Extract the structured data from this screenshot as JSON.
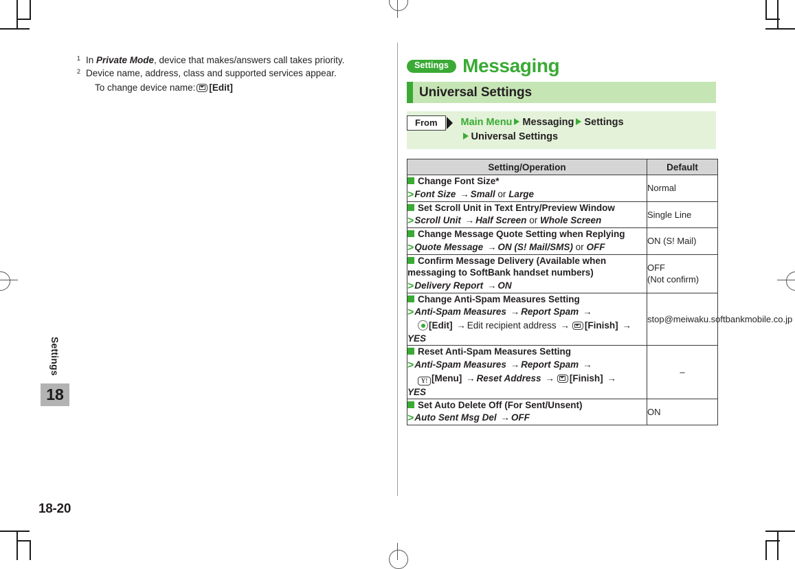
{
  "footnotes": [
    {
      "marker": "1",
      "pre": "In ",
      "emphasis": "Private Mode",
      "post": ", device that makes/answers call takes priority."
    },
    {
      "marker": "2",
      "pre": "",
      "emphasis": "",
      "post": "Device name, address, class and supported services appear.",
      "sub_pre": "To change device name: ",
      "sub_key": "envelope-key-icon",
      "sub_post": "[Edit]"
    }
  ],
  "side_tab": {
    "label": "Settings",
    "chapter": "18"
  },
  "folio": "18-20",
  "header": {
    "pill": "Settings",
    "title": "Messaging",
    "section": "Universal Settings"
  },
  "from_block": {
    "tag": "From",
    "crumbs_line1": [
      "Main Menu",
      "Messaging",
      "Settings"
    ],
    "crumbs_line2": [
      "Universal Settings"
    ]
  },
  "table": {
    "columns": [
      "Setting/Operation",
      "Default"
    ],
    "rows": [
      {
        "heading": "Change Font Size*",
        "steps": [
          {
            "parts": [
              {
                "t": "Font Size",
                "s": "bi"
              },
              {
                "t": "→",
                "s": "arrow"
              },
              {
                "t": "Small",
                "s": "bi"
              },
              {
                "t": "or",
                "s": "plain"
              },
              {
                "t": "Large",
                "s": "bi"
              }
            ]
          }
        ],
        "default": "Normal",
        "default_align": "left"
      },
      {
        "heading": "Set Scroll Unit in Text Entry/Preview Window",
        "steps": [
          {
            "parts": [
              {
                "t": "Scroll Unit",
                "s": "bi"
              },
              {
                "t": "→",
                "s": "arrow"
              },
              {
                "t": "Half Screen",
                "s": "bi"
              },
              {
                "t": "or",
                "s": "plain"
              },
              {
                "t": "Whole Screen",
                "s": "bi"
              }
            ]
          }
        ],
        "default": "Single Line",
        "default_align": "left"
      },
      {
        "heading": "Change Message Quote Setting when Replying",
        "steps": [
          {
            "parts": [
              {
                "t": "Quote Message",
                "s": "bi"
              },
              {
                "t": "→",
                "s": "arrow"
              },
              {
                "t": "ON (S! Mail/SMS)",
                "s": "bi"
              },
              {
                "t": "or",
                "s": "plain"
              },
              {
                "t": "OFF",
                "s": "bi"
              }
            ]
          }
        ],
        "default": "ON (S! Mail)",
        "default_align": "left"
      },
      {
        "heading": "Confirm Message Delivery (Available when messaging to SoftBank handset numbers)",
        "steps": [
          {
            "parts": [
              {
                "t": "Delivery Report",
                "s": "bi"
              },
              {
                "t": "→",
                "s": "arrow"
              },
              {
                "t": "ON",
                "s": "bi"
              }
            ]
          }
        ],
        "default": "OFF\n(Not confirm)",
        "default_align": "left"
      },
      {
        "heading": "Change Anti-Spam Measures Setting",
        "steps": [
          {
            "parts": [
              {
                "t": "Anti-Spam Measures",
                "s": "bi"
              },
              {
                "t": "→",
                "s": "arrow"
              },
              {
                "t": "Report Spam",
                "s": "bi"
              },
              {
                "t": "→",
                "s": "arrow"
              }
            ]
          },
          {
            "indent": true,
            "parts": [
              {
                "t": "center-key-icon",
                "s": "key-center"
              },
              {
                "t": "[Edit]",
                "s": "b"
              },
              {
                "t": "→",
                "s": "arrow"
              },
              {
                "t": "Edit recipient address",
                "s": "plain"
              },
              {
                "t": "→",
                "s": "arrow"
              },
              {
                "t": "envelope-key-icon",
                "s": "key-env"
              },
              {
                "t": "[Finish]",
                "s": "b"
              },
              {
                "t": "→",
                "s": "arrow"
              }
            ]
          },
          {
            "parts": [
              {
                "t": "YES",
                "s": "bi"
              }
            ]
          }
        ],
        "default": "stop@meiwaku.softbankmobile.co.jp",
        "default_align": "left"
      },
      {
        "heading": "Reset Anti-Spam Measures Setting",
        "steps": [
          {
            "parts": [
              {
                "t": "Anti-Spam Measures",
                "s": "bi"
              },
              {
                "t": "→",
                "s": "arrow"
              },
              {
                "t": "Report Spam",
                "s": "bi"
              },
              {
                "t": "→",
                "s": "arrow"
              }
            ]
          },
          {
            "indent": true,
            "parts": [
              {
                "t": "ymenu-key-icon",
                "s": "key-ym"
              },
              {
                "t": "[Menu]",
                "s": "b"
              },
              {
                "t": "→",
                "s": "arrow"
              },
              {
                "t": "Reset Address",
                "s": "bi"
              },
              {
                "t": "→",
                "s": "arrow"
              },
              {
                "t": "envelope-key-icon",
                "s": "key-env"
              },
              {
                "t": "[Finish]",
                "s": "b"
              },
              {
                "t": "→",
                "s": "arrow"
              }
            ]
          },
          {
            "parts": [
              {
                "t": "YES",
                "s": "bi"
              }
            ]
          }
        ],
        "default": "–",
        "default_align": "center"
      },
      {
        "heading": "Set Auto Delete Off (For Sent/Unsent)",
        "steps": [
          {
            "parts": [
              {
                "t": "Auto Sent Msg Del",
                "s": "bi"
              },
              {
                "t": "→",
                "s": "arrow"
              },
              {
                "t": "OFF",
                "s": "bi"
              }
            ]
          }
        ],
        "default": "ON",
        "default_align": "left"
      }
    ]
  },
  "colors": {
    "brand_green": "#3aaa35",
    "section_bg": "#c6e5b4",
    "from_bg": "#e3f2d9",
    "table_header_bg": "#d5d5d5",
    "chapter_tab_bg": "#b3b3b3"
  }
}
